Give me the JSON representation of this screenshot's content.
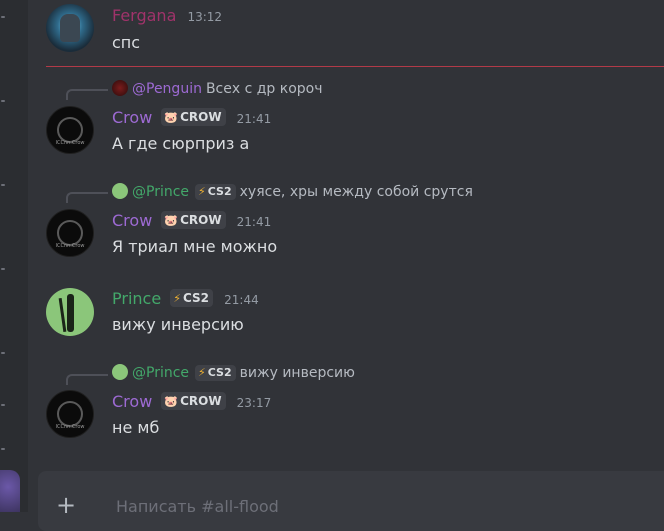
{
  "channel": {
    "input_placeholder": "Написать #all-flood"
  },
  "colors": {
    "fergana": "#a0336a",
    "crow": "#9d6ad3",
    "prince": "#43a86a",
    "penguin": "#9d6ad3"
  },
  "messages": [
    {
      "author": "Fergana",
      "time": "13:12",
      "text": "спс"
    },
    {
      "author": "Crow",
      "tag": "CROW",
      "tag_icon": "pig-icon",
      "time": "21:41",
      "text": "А где сюрприз а",
      "reply": {
        "author": "@Penguin",
        "text": "Всех с др короч"
      }
    },
    {
      "author": "Crow",
      "tag": "CROW",
      "tag_icon": "pig-icon",
      "time": "21:41",
      "text": "Я триал мне можно",
      "reply": {
        "author": "@Prince",
        "tag": "CS2",
        "tag_icon": "lightning-icon",
        "text": "хуясе, хры между собой срутся"
      }
    },
    {
      "author": "Prince",
      "tag": "CS2",
      "tag_icon": "lightning-icon",
      "time": "21:44",
      "text": "вижу инверсию"
    },
    {
      "author": "Crow",
      "tag": "CROW",
      "tag_icon": "pig-icon",
      "time": "23:17",
      "text": "не мб",
      "reply": {
        "author": "@Prince",
        "tag": "CS2",
        "tag_icon": "lightning-icon",
        "text": "вижу инверсию"
      }
    }
  ]
}
